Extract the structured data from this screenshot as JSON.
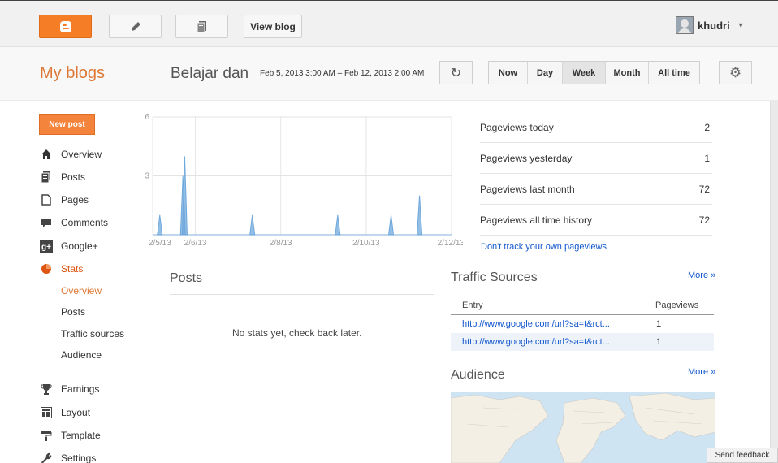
{
  "topbar": {
    "view_blog": "View blog",
    "username": "khudri",
    "icons": [
      "blogger-logo-icon",
      "pencil-icon",
      "pages-icon"
    ]
  },
  "header": {
    "my_blogs": "My blogs",
    "blog_name": "Belajar dan",
    "date_range": "Feb 5, 2013 3:00 AM – Feb 12, 2013 2:00 AM",
    "ranges": [
      "Now",
      "Day",
      "Week",
      "Month",
      "All time"
    ],
    "active_range": "Week"
  },
  "sidebar": {
    "new_post": "New post",
    "items": [
      {
        "label": "Overview",
        "icon": "home-icon"
      },
      {
        "label": "Posts",
        "icon": "posts-icon"
      },
      {
        "label": "Pages",
        "icon": "pages-icon"
      },
      {
        "label": "Comments",
        "icon": "comment-icon"
      },
      {
        "label": "Google+",
        "icon": "google-plus-icon"
      },
      {
        "label": "Stats",
        "icon": "pie-chart-icon"
      }
    ],
    "stats_sub": [
      "Overview",
      "Posts",
      "Traffic sources",
      "Audience"
    ],
    "items2": [
      {
        "label": "Earnings",
        "icon": "trophy-icon"
      },
      {
        "label": "Layout",
        "icon": "layout-icon"
      },
      {
        "label": "Template",
        "icon": "paint-roller-icon"
      },
      {
        "label": "Settings",
        "icon": "wrench-icon"
      }
    ]
  },
  "chart_data": {
    "type": "area",
    "y_ticks": [
      6,
      3
    ],
    "ylim": [
      0,
      6
    ],
    "x_ticks": [
      "2/5/13",
      "2/6/13",
      "2/8/13",
      "2/10/13",
      "2/12/13"
    ],
    "x_range": [
      "2/5/13",
      "2/12/13"
    ],
    "series": [
      {
        "color": "#6fa8dc",
        "x": [
          "2013-02-05 04:00",
          "2013-02-05 17:00",
          "2013-02-05 18:00",
          "2013-02-07 08:00",
          "2013-02-09 08:00",
          "2013-02-10 14:00",
          "2013-02-11 06:00"
        ],
        "values": [
          1,
          3,
          4,
          1,
          1,
          1,
          2
        ]
      }
    ]
  },
  "posts": {
    "title": "Posts",
    "empty": "No stats yet, check back later."
  },
  "pageviews": {
    "rows": [
      {
        "label": "Pageviews today",
        "value": "2"
      },
      {
        "label": "Pageviews yesterday",
        "value": "1"
      },
      {
        "label": "Pageviews last month",
        "value": "72"
      },
      {
        "label": "Pageviews all time history",
        "value": "72"
      }
    ],
    "dont_track": "Don't track your own pageviews"
  },
  "traffic": {
    "title": "Traffic Sources",
    "more": "More »",
    "headers": [
      "Entry",
      "Pageviews"
    ],
    "rows": [
      {
        "entry": "http://www.google.com/url?sa=t&rct...",
        "pageviews": "1"
      },
      {
        "entry": "http://www.google.com/url?sa=t&rct...",
        "pageviews": "1"
      }
    ]
  },
  "audience": {
    "title": "Audience",
    "more": "More »"
  },
  "feedback": "Send feedback",
  "colors": {
    "accent": "#dd7733",
    "link": "#1155cc",
    "chart": "#6fa8dc"
  }
}
